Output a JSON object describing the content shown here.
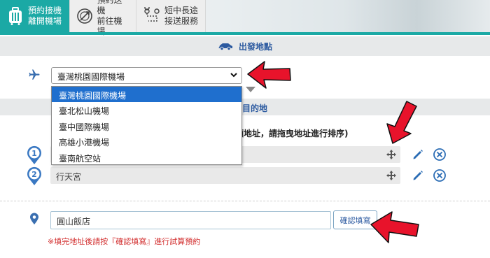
{
  "tabs": [
    {
      "line1": "預約接機",
      "line2": "離開機場",
      "icon": "luggage-icon",
      "active": true
    },
    {
      "line1": "預約送機",
      "line2": "前往機場",
      "icon": "compass-plane-icon",
      "active": false
    },
    {
      "line1": "短中長途",
      "line2": "接送服務",
      "icon": "route-icon",
      "active": false
    }
  ],
  "departure": {
    "label": "出發地點",
    "icon": "car-icon"
  },
  "airport_select": {
    "value": "臺灣桃園國際機場",
    "options": [
      "臺灣桃園國際機場",
      "臺北松山機場",
      "臺中國際機場",
      "高雄小港機場",
      "臺南航空站"
    ]
  },
  "destination": {
    "label": "目的地"
  },
  "multi_hint": "有多項地址，請拖曳地址進行排序)",
  "stops": [
    {
      "index": "1",
      "address": ""
    },
    {
      "index": "2",
      "address": "行天宮"
    }
  ],
  "address_input": {
    "value": "圓山飯店"
  },
  "confirm_label": "確認填寫",
  "warning": "※填完地址後請按『確認填寫』進行試算預約",
  "colors": {
    "teal": "#1ba9a5",
    "blue": "#2c5aa0",
    "red_arrow": "#e8132b",
    "warn": "#d22d2d"
  }
}
